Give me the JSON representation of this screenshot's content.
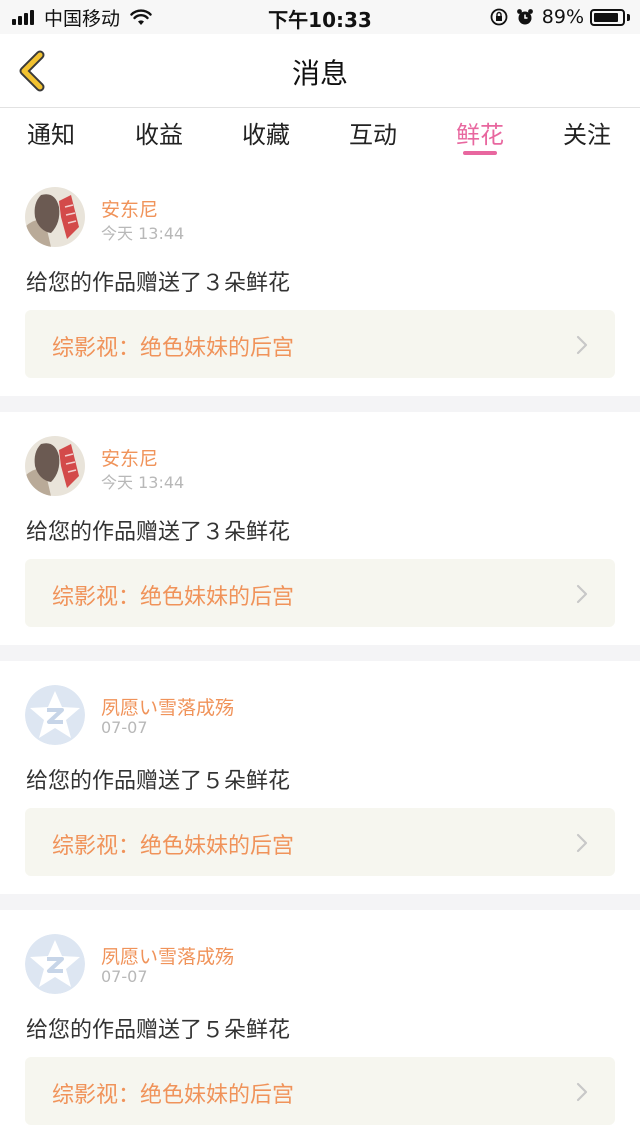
{
  "status_bar": {
    "carrier": "中国移动",
    "time": "下午10:33",
    "battery": "89%",
    "battery_level": 0.89
  },
  "nav": {
    "title": "消息"
  },
  "tabs": [
    {
      "label": "通知"
    },
    {
      "label": "收益"
    },
    {
      "label": "收藏"
    },
    {
      "label": "互动"
    },
    {
      "label": "鲜花",
      "active": true
    },
    {
      "label": "关注"
    }
  ],
  "messages": [
    {
      "user": "安东尼",
      "time": "今天 13:44",
      "text": "给您的作品赠送了３朵鲜花",
      "work": "综影视：绝色妹妹的后宫",
      "avatar": "photo-avatar"
    },
    {
      "user": "安东尼",
      "time": "今天 13:44",
      "text": "给您的作品赠送了３朵鲜花",
      "work": "综影视：绝色妹妹的后宫",
      "avatar": "photo-avatar"
    },
    {
      "user": "夙愿い雪落成殇",
      "time": "07-07",
      "text": "给您的作品赠送了５朵鲜花",
      "work": "综影视：绝色妹妹的后宫",
      "avatar": "default-star-avatar"
    },
    {
      "user": "夙愿い雪落成殇",
      "time": "07-07",
      "text": "给您的作品赠送了５朵鲜花",
      "work": "综影视：绝色妹妹的后宫",
      "avatar": "default-star-avatar"
    }
  ],
  "colors": {
    "accent": "#e8679f",
    "username": "#f0935a",
    "back_arrow": "#f2c230",
    "link_bg": "#f6f6ef"
  }
}
